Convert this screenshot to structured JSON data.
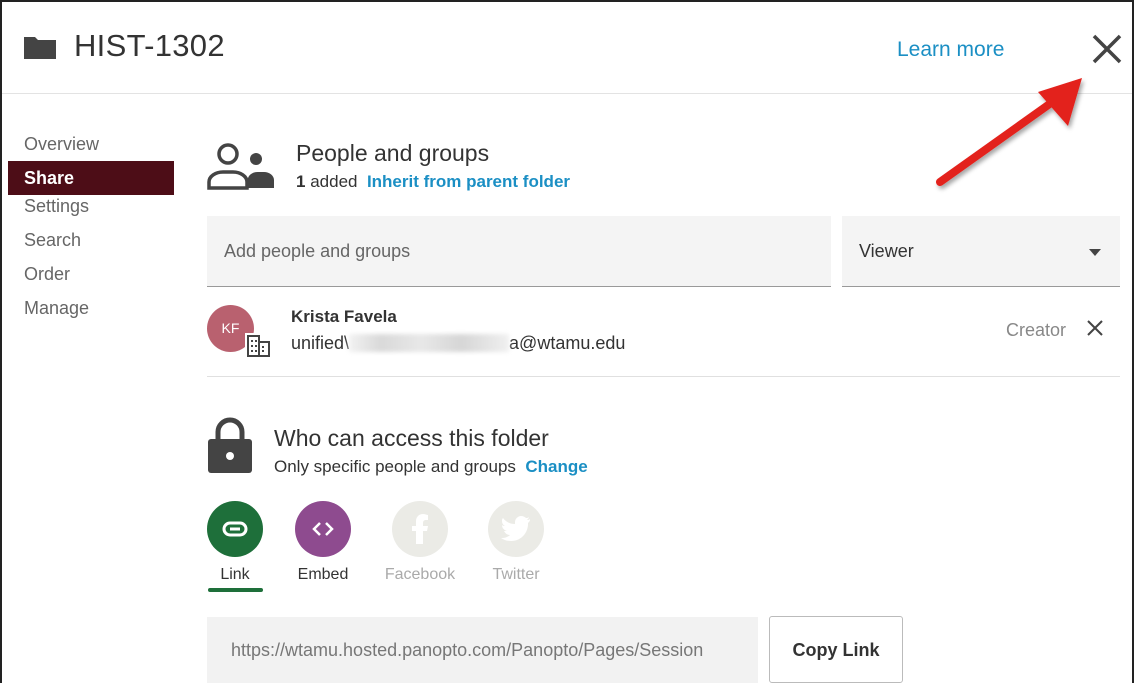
{
  "header": {
    "title": "HIST-1302",
    "learn_more": "Learn more",
    "icons": {
      "folder": "folder-icon",
      "close": "close-icon"
    }
  },
  "sidebar": {
    "items": [
      {
        "label": "Overview",
        "active": false
      },
      {
        "label": "Share",
        "active": true
      },
      {
        "label": "Settings",
        "active": false
      },
      {
        "label": "Search",
        "active": false
      },
      {
        "label": "Order",
        "active": false
      },
      {
        "label": "Manage",
        "active": false
      }
    ]
  },
  "people": {
    "title": "People and groups",
    "count": "1",
    "count_suffix": "added",
    "inherit_link": "Inherit from parent folder",
    "add_placeholder": "Add people and groups",
    "role_selected": "Viewer",
    "users": [
      {
        "initials": "KF",
        "name": "Krista Favela",
        "email_prefix": "unified\\",
        "email_suffix": "a@wtamu.edu",
        "role": "Creator"
      }
    ]
  },
  "access": {
    "title": "Who can access this folder",
    "subtitle": "Only specific people and groups",
    "change_link": "Change"
  },
  "share": {
    "options": [
      {
        "label": "Link",
        "color": "#1e6f3a",
        "icon": "link-icon",
        "enabled": true,
        "selected": true
      },
      {
        "label": "Embed",
        "color": "#8e4b8f",
        "icon": "embed-code-icon",
        "enabled": true,
        "selected": false
      },
      {
        "label": "Facebook",
        "color": "#ebebe6",
        "icon": "facebook-icon",
        "enabled": false,
        "selected": false
      },
      {
        "label": "Twitter",
        "color": "#ebebe6",
        "icon": "twitter-icon",
        "enabled": false,
        "selected": false
      }
    ],
    "link_url": "https://wtamu.hosted.panopto.com/Panopto/Pages/Session",
    "copy_label": "Copy Link"
  },
  "colors": {
    "accent_blue": "#1b8fc4",
    "active_nav": "#4d0d17",
    "annotation_arrow": "#e3201b"
  }
}
